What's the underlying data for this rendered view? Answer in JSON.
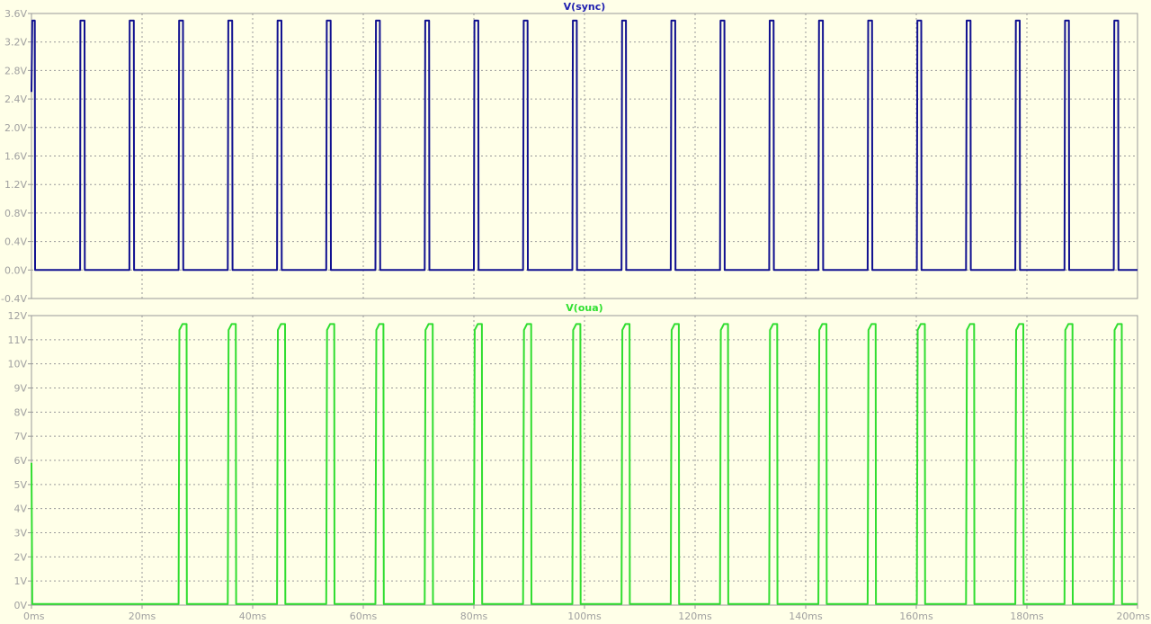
{
  "chart_data": [
    {
      "type": "line",
      "title": "V(sync)",
      "title_color": "#2020b0",
      "ylim": [
        -0.4,
        3.6
      ],
      "yticks": [
        -0.4,
        0.0,
        0.4,
        0.8,
        1.2,
        1.6,
        2.0,
        2.4,
        2.8,
        3.2,
        3.6
      ],
      "ytick_labels": [
        "-0.4V",
        "0.0V",
        "0.4V",
        "0.8V",
        "1.2V",
        "1.6V",
        "2.0V",
        "2.4V",
        "2.8V",
        "3.2V",
        "3.6V"
      ],
      "grid": true,
      "series": [
        {
          "name": "V(sync)",
          "color": "#101090",
          "x": [
            0.0,
            0.15,
            0.2,
            0.6,
            0.65,
            0.72,
            8.8,
            8.85,
            9.6,
            9.65,
            17.7,
            17.75,
            18.5,
            18.55,
            26.6,
            26.7,
            27.4,
            27.45,
            35.5,
            35.6,
            36.3,
            36.35,
            44.4,
            44.5,
            45.2,
            45.25,
            53.3,
            53.4,
            54.1,
            54.15,
            62.2,
            62.3,
            63.0,
            63.05,
            71.1,
            71.2,
            71.9,
            71.95,
            80.0,
            80.1,
            80.8,
            80.85,
            88.9,
            89.0,
            89.7,
            89.75,
            97.8,
            97.9,
            98.6,
            98.65,
            106.7,
            106.8,
            107.5,
            107.55,
            115.6,
            115.7,
            116.4,
            116.45,
            124.5,
            124.6,
            125.3,
            125.35,
            133.4,
            133.5,
            134.2,
            134.25,
            142.3,
            142.4,
            143.1,
            143.15,
            151.2,
            151.3,
            152.0,
            152.05,
            160.1,
            160.2,
            160.9,
            160.95,
            169.0,
            169.1,
            169.8,
            169.85,
            177.9,
            178.0,
            178.7,
            178.75,
            186.8,
            186.9,
            187.6,
            187.65,
            195.7,
            195.8,
            196.5,
            196.55,
            200.0
          ],
          "y": [
            2.5,
            3.5,
            3.5,
            3.5,
            0.0,
            0.0,
            0.0,
            3.5,
            3.5,
            0.0,
            0.0,
            3.5,
            3.5,
            0.0,
            0.0,
            3.5,
            3.5,
            0.0,
            0.0,
            3.5,
            3.5,
            0.0,
            0.0,
            3.5,
            3.5,
            0.0,
            0.0,
            3.5,
            3.5,
            0.0,
            0.0,
            3.5,
            3.5,
            0.0,
            0.0,
            3.5,
            3.5,
            0.0,
            0.0,
            3.5,
            3.5,
            0.0,
            0.0,
            3.5,
            3.5,
            0.0,
            0.0,
            3.5,
            3.5,
            0.0,
            0.0,
            3.5,
            3.5,
            0.0,
            0.0,
            3.5,
            3.5,
            0.0,
            0.0,
            3.5,
            3.5,
            0.0,
            0.0,
            3.5,
            3.5,
            0.0,
            0.0,
            3.5,
            3.5,
            0.0,
            0.0,
            3.5,
            3.5,
            0.0,
            0.0,
            3.5,
            3.5,
            0.0,
            0.0,
            3.5,
            3.5,
            0.0,
            0.0,
            3.5,
            3.5,
            0.0,
            0.0,
            3.5,
            3.5,
            0.0,
            0.0,
            3.5,
            3.5,
            0.0,
            0.0
          ]
        }
      ]
    },
    {
      "type": "line",
      "title": "V(oua)",
      "title_color": "#30e030",
      "ylim": [
        0,
        12
      ],
      "yticks": [
        0,
        1,
        2,
        3,
        4,
        5,
        6,
        7,
        8,
        9,
        10,
        11,
        12
      ],
      "ytick_labels": [
        "0V",
        "1V",
        "2V",
        "3V",
        "4V",
        "5V",
        "6V",
        "7V",
        "8V",
        "9V",
        "10V",
        "11V",
        "12V"
      ],
      "grid": true,
      "series": [
        {
          "name": "V(oua)",
          "color": "#30dd30",
          "x": [
            0.0,
            0.15,
            26.6,
            26.75,
            27.3,
            28.05,
            28.1,
            35.5,
            35.65,
            36.2,
            36.95,
            37.0,
            44.4,
            44.55,
            45.1,
            45.85,
            45.9,
            53.3,
            53.45,
            54.0,
            54.75,
            54.8,
            62.2,
            62.35,
            62.9,
            63.65,
            63.7,
            71.1,
            71.25,
            71.8,
            72.55,
            72.6,
            80.0,
            80.15,
            80.7,
            81.45,
            81.5,
            88.9,
            89.05,
            89.6,
            90.35,
            90.4,
            97.8,
            97.95,
            98.5,
            99.25,
            99.3,
            106.7,
            106.85,
            107.4,
            108.15,
            108.2,
            115.6,
            115.75,
            116.3,
            117.05,
            117.1,
            124.5,
            124.65,
            125.2,
            125.95,
            126.0,
            133.4,
            133.55,
            134.1,
            134.85,
            134.9,
            142.3,
            142.45,
            143.0,
            143.75,
            143.8,
            151.2,
            151.35,
            151.9,
            152.65,
            152.7,
            160.1,
            160.25,
            160.8,
            161.55,
            161.6,
            169.0,
            169.15,
            169.7,
            170.45,
            170.5,
            177.9,
            178.05,
            178.6,
            179.35,
            179.4,
            186.8,
            186.95,
            187.5,
            188.25,
            188.3,
            195.7,
            195.85,
            196.4,
            197.15,
            197.2,
            200.0
          ],
          "y": [
            5.9,
            0.05,
            0.05,
            11.4,
            11.65,
            11.65,
            0.05,
            0.05,
            11.4,
            11.65,
            11.65,
            0.05,
            0.05,
            11.4,
            11.65,
            11.65,
            0.05,
            0.05,
            11.4,
            11.65,
            11.65,
            0.05,
            0.05,
            11.4,
            11.65,
            11.65,
            0.05,
            0.05,
            11.4,
            11.65,
            11.65,
            0.05,
            0.05,
            11.4,
            11.65,
            11.65,
            0.05,
            0.05,
            11.4,
            11.65,
            11.65,
            0.05,
            0.05,
            11.4,
            11.65,
            11.65,
            0.05,
            0.05,
            11.4,
            11.65,
            11.65,
            0.05,
            0.05,
            11.4,
            11.65,
            11.65,
            0.05,
            0.05,
            11.4,
            11.65,
            11.65,
            0.05,
            0.05,
            11.4,
            11.65,
            11.65,
            0.05,
            0.05,
            11.4,
            11.65,
            11.65,
            0.05,
            0.05,
            11.4,
            11.65,
            11.65,
            0.05,
            0.05,
            11.4,
            11.65,
            11.65,
            0.05,
            0.05,
            11.4,
            11.65,
            11.65,
            0.05,
            0.05,
            11.4,
            11.65,
            11.65,
            0.05,
            0.05,
            11.4,
            11.65,
            11.65,
            0.05,
            0.05,
            11.4,
            11.65,
            11.65,
            0.05,
            0.05
          ]
        }
      ]
    }
  ],
  "x_axis": {
    "xlim": [
      0,
      200
    ],
    "ticks": [
      0,
      20,
      40,
      60,
      80,
      100,
      120,
      140,
      160,
      180,
      200
    ],
    "tick_labels": [
      "0ms",
      "20ms",
      "40ms",
      "60ms",
      "80ms",
      "100ms",
      "120ms",
      "140ms",
      "160ms",
      "180ms",
      "200ms"
    ]
  },
  "style": {
    "background": "#ffffe8",
    "grid_color": "#9a9a9a",
    "frame_color": "#9a9a9a",
    "tick_label_color": "#a0a0a0"
  }
}
